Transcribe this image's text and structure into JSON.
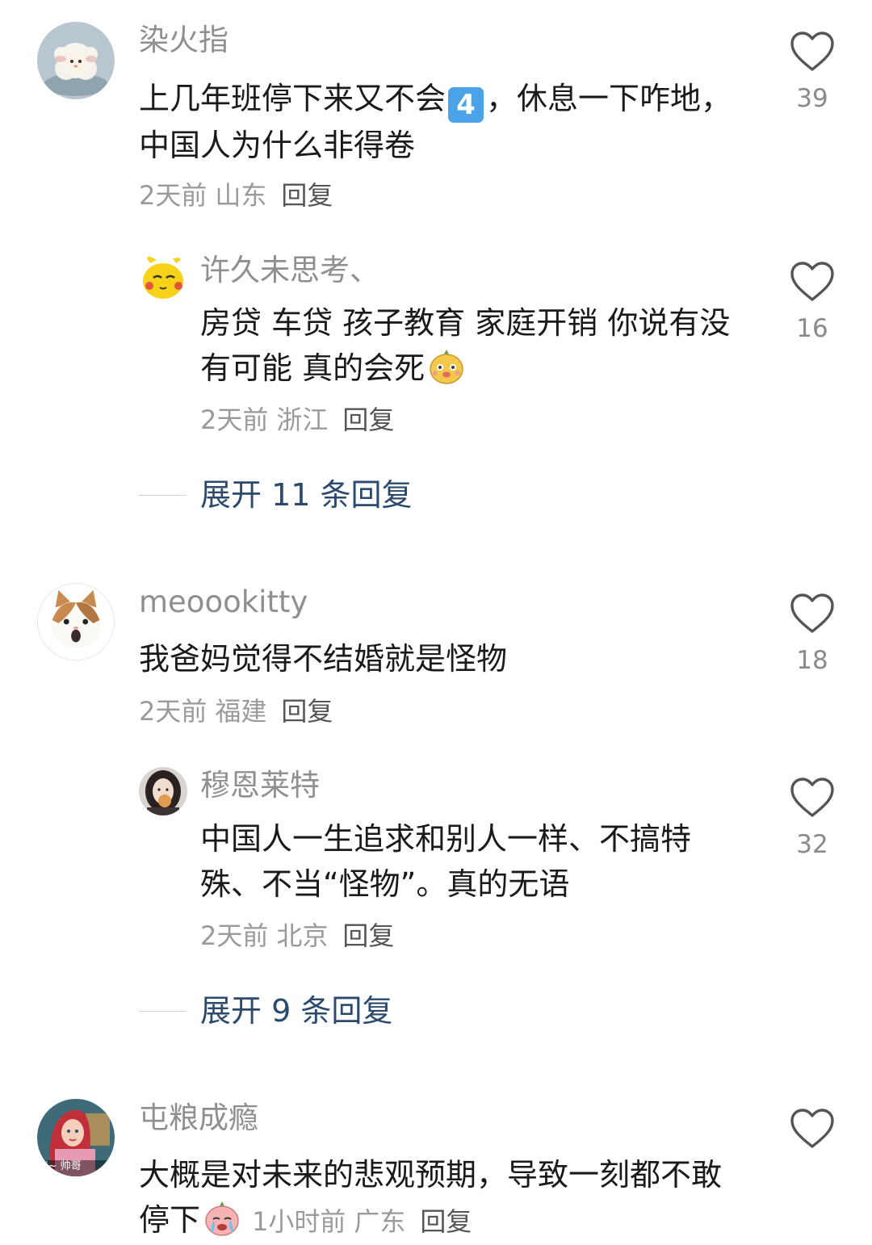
{
  "comments": [
    {
      "username": "染火指",
      "text_before": "上几年班停下来又不会",
      "emoji_key": "4",
      "text_after": "，休息一下咋地，中国人为什么非得卷",
      "time": "2天前",
      "location": "山东",
      "reply_label": "回复",
      "likes": "39",
      "avatar_icon": "lamb-avatar",
      "replies": [
        {
          "username": "许久未思考、",
          "text": "房贷 车贷 孩子教育 家庭开销 你说有没有可能 真的会死",
          "emoji": "face-emoji",
          "time": "2天前",
          "location": "浙江",
          "reply_label": "回复",
          "likes": "16",
          "avatar_icon": "pikachu-avatar"
        }
      ],
      "expand_label": "展开 11 条回复"
    },
    {
      "username": "meoookitty",
      "text": "我爸妈觉得不结婚就是怪物",
      "time": "2天前",
      "location": "福建",
      "reply_label": "回复",
      "likes": "18",
      "avatar_icon": "cat-avatar",
      "replies": [
        {
          "username": "穆恩莱特",
          "text": "中国人一生追求和别人一样、不搞特殊、不当“怪物”。真的无语",
          "time": "2天前",
          "location": "北京",
          "reply_label": "回复",
          "likes": "32",
          "avatar_icon": "girl-avatar"
        }
      ],
      "expand_label": "展开 9 条回复"
    },
    {
      "username": "屯粮成瘾",
      "text": "大概是对未来的悲观预期，导致一刻都不敢停下",
      "emoji": "crying-emoji",
      "time": "1小时前",
      "location": "广东",
      "reply_label": "回复",
      "avatar_icon": "princess-avatar",
      "avatar_caption": "i~ 帅哥"
    }
  ],
  "colors": {
    "username": "#8f8f8f",
    "text": "#1a1a1a",
    "meta": "#9a9a9a",
    "expand": "#2b4a6e",
    "heart": "#555555"
  }
}
